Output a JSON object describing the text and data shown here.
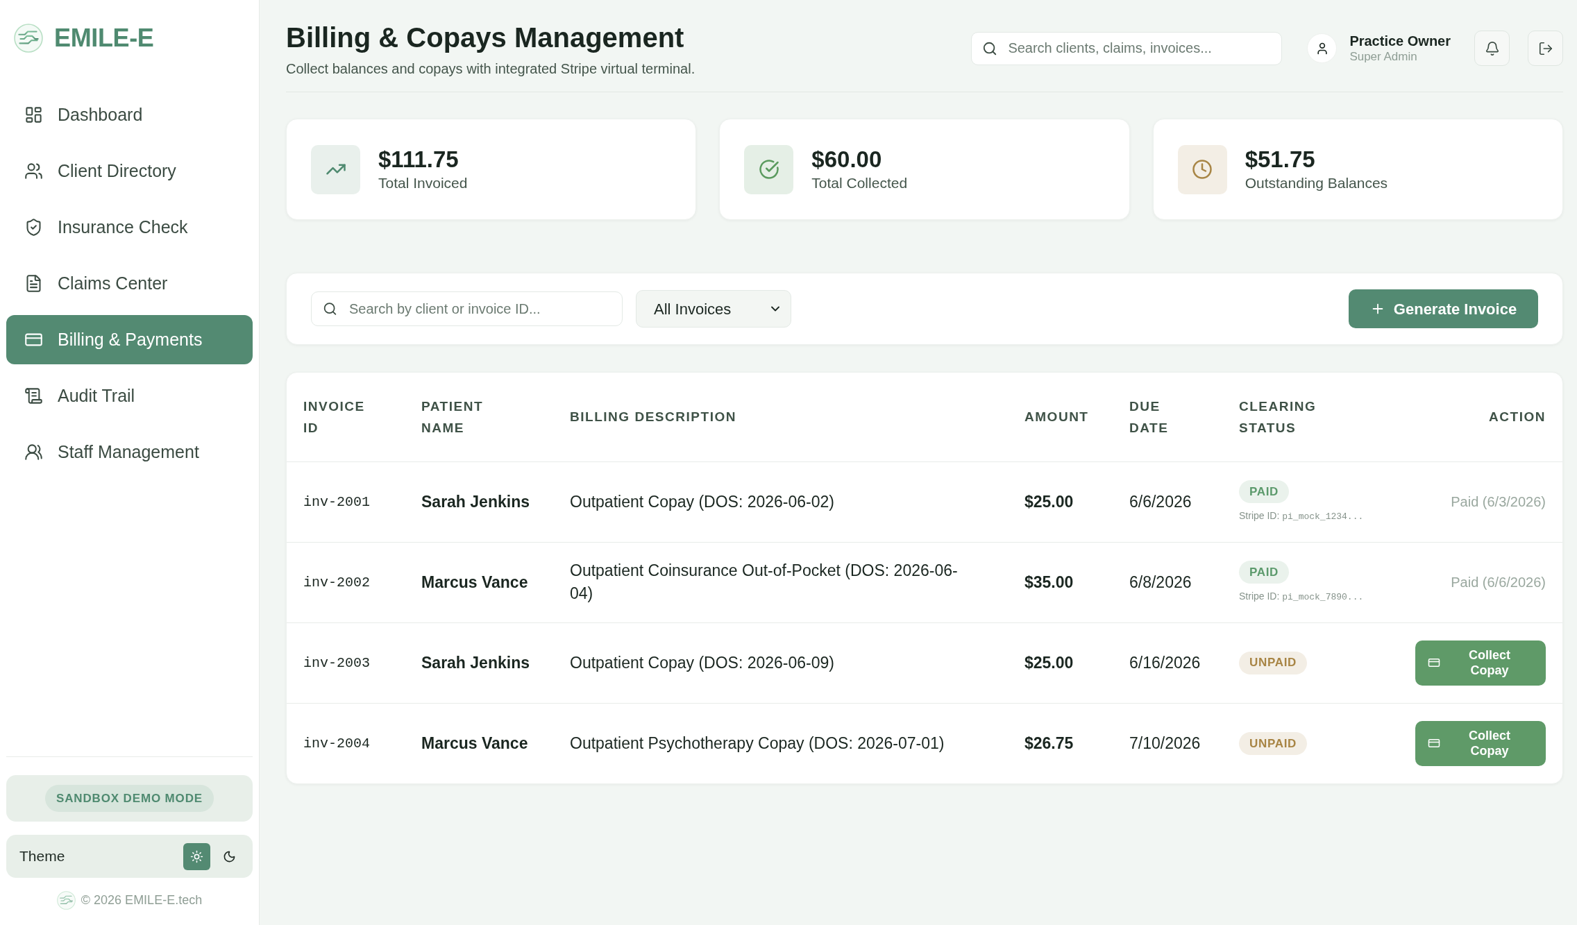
{
  "sidebar": {
    "brand": "EMILE-E",
    "nav": [
      {
        "label": "Dashboard",
        "selected": false
      },
      {
        "label": "Client Directory",
        "selected": false
      },
      {
        "label": "Insurance Check",
        "selected": false
      },
      {
        "label": "Claims Center",
        "selected": false
      },
      {
        "label": "Billing & Payments",
        "selected": true
      },
      {
        "label": "Audit Trail",
        "selected": false
      },
      {
        "label": "Staff Management",
        "selected": false
      }
    ],
    "sandbox_badge": "SANDBOX DEMO MODE",
    "theme": {
      "label": "Theme",
      "options": [
        {
          "kind": "light",
          "selected": true
        },
        {
          "kind": "dark",
          "selected": false
        }
      ]
    },
    "footer": "© 2026 EMILE-E.tech"
  },
  "header": {
    "title": "Billing & Copays Management",
    "subtitle": "Collect balances and copays with integrated Stripe virtual terminal.",
    "search": {
      "placeholder": "Search clients, claims, invoices..."
    },
    "user": {
      "name": "Practice Owner",
      "role": "Super Admin"
    }
  },
  "stats": [
    {
      "kind": "invoiced",
      "value": "$111.75",
      "label": "Total Invoiced"
    },
    {
      "kind": "collected",
      "value": "$60.00",
      "label": "Total Collected"
    },
    {
      "kind": "outstanding",
      "value": "$51.75",
      "label": "Outstanding Balances"
    }
  ],
  "toolbar": {
    "search": {
      "placeholder": "Search by client or invoice ID..."
    },
    "filter": {
      "value": "All Invoices"
    },
    "button": "Generate Invoice"
  },
  "table": {
    "columns": [
      "INVOICE ID",
      "PATIENT NAME",
      "BILLING DESCRIPTION",
      "AMOUNT",
      "DUE DATE",
      "CLEARING STATUS",
      "ACTION"
    ],
    "rows": [
      {
        "invoice_id": "inv-2001",
        "patient": "Sarah Jenkins",
        "description": "Outpatient Copay (DOS: 2026-06-02)",
        "amount": "$25.00",
        "due_date": "6/6/2026",
        "status": {
          "kind": "paid",
          "label": "PAID",
          "stripe_label": "Stripe ID:",
          "stripe_id": "pi_mock_1234..."
        },
        "action": {
          "kind": "note",
          "text": "Paid (6/3/2026)"
        }
      },
      {
        "invoice_id": "inv-2002",
        "patient": "Marcus Vance",
        "description": "Outpatient Coinsurance Out-of-Pocket (DOS: 2026-06-04)",
        "amount": "$35.00",
        "due_date": "6/8/2026",
        "status": {
          "kind": "paid",
          "label": "PAID",
          "stripe_label": "Stripe ID:",
          "stripe_id": "pi_mock_7890..."
        },
        "action": {
          "kind": "note",
          "text": "Paid (6/6/2026)"
        }
      },
      {
        "invoice_id": "inv-2003",
        "patient": "Sarah Jenkins",
        "description": "Outpatient Copay (DOS: 2026-06-09)",
        "amount": "$25.00",
        "due_date": "6/16/2026",
        "status": {
          "kind": "unpaid",
          "label": "UNPAID"
        },
        "action": {
          "kind": "button",
          "text": "Collect Copay"
        }
      },
      {
        "invoice_id": "inv-2004",
        "patient": "Marcus Vance",
        "description": "Outpatient Psychotherapy Copay (DOS: 2026-07-01)",
        "amount": "$26.75",
        "due_date": "7/10/2026",
        "status": {
          "kind": "unpaid",
          "label": "UNPAID"
        },
        "action": {
          "kind": "button",
          "text": "Collect Copay"
        }
      }
    ]
  }
}
